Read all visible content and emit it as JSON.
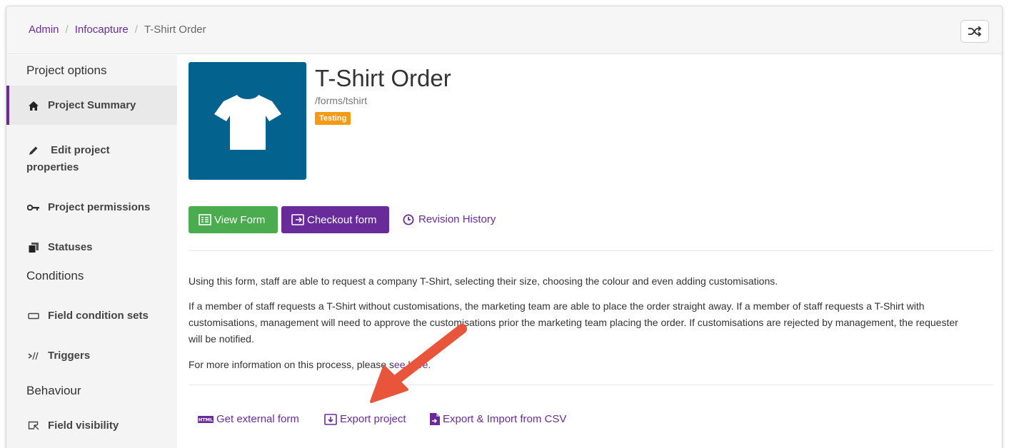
{
  "breadcrumb": {
    "items": [
      "Admin",
      "Infocapture"
    ],
    "current": "T-Shirt Order",
    "separator": "/"
  },
  "header": {
    "shuffle_icon": "shuffle-icon"
  },
  "sidebar": {
    "heading_project": "Project options",
    "project_summary": "Project Summary",
    "edit_properties": "Edit project properties",
    "permissions": "Project permissions",
    "statuses": "Statuses",
    "heading_conditions": "Conditions",
    "field_condition_sets": "Field condition sets",
    "triggers": "Triggers",
    "heading_behaviour": "Behaviour",
    "field_visibility": "Field visibility"
  },
  "project": {
    "title": "T-Shirt Order",
    "path": "/forms/tshirt",
    "status_badge": "Testing",
    "image_icon": "tshirt-icon"
  },
  "actions": {
    "view_form": "View Form",
    "checkout_form": "Checkout form",
    "revision_history": "Revision History"
  },
  "description": {
    "para1": "Using this form, staff are able to request a company T-Shirt, selecting their size, choosing the colour and even adding customisations.",
    "para2": "If a member of staff requests a T-Shirt without customisations, the marketing team are able to place the order straight away. If a member of staff requests a T-Shirt with customisations, management will need to approve the customisations prior the marketing team placing the order. If customisations are rejected by management, the requester will be notified.",
    "para3_prefix": "For more information on this process, please s",
    "para3_link": "ee here."
  },
  "footer_links": {
    "external_form": "Get external form",
    "export_project": "Export project",
    "export_import_csv": "Export & Import from CSV"
  },
  "colors": {
    "accent": "#6a2b9a",
    "green": "#4aac4e",
    "badge": "#f59a12",
    "thumb": "#04628e",
    "arrow": "#e8553b"
  }
}
